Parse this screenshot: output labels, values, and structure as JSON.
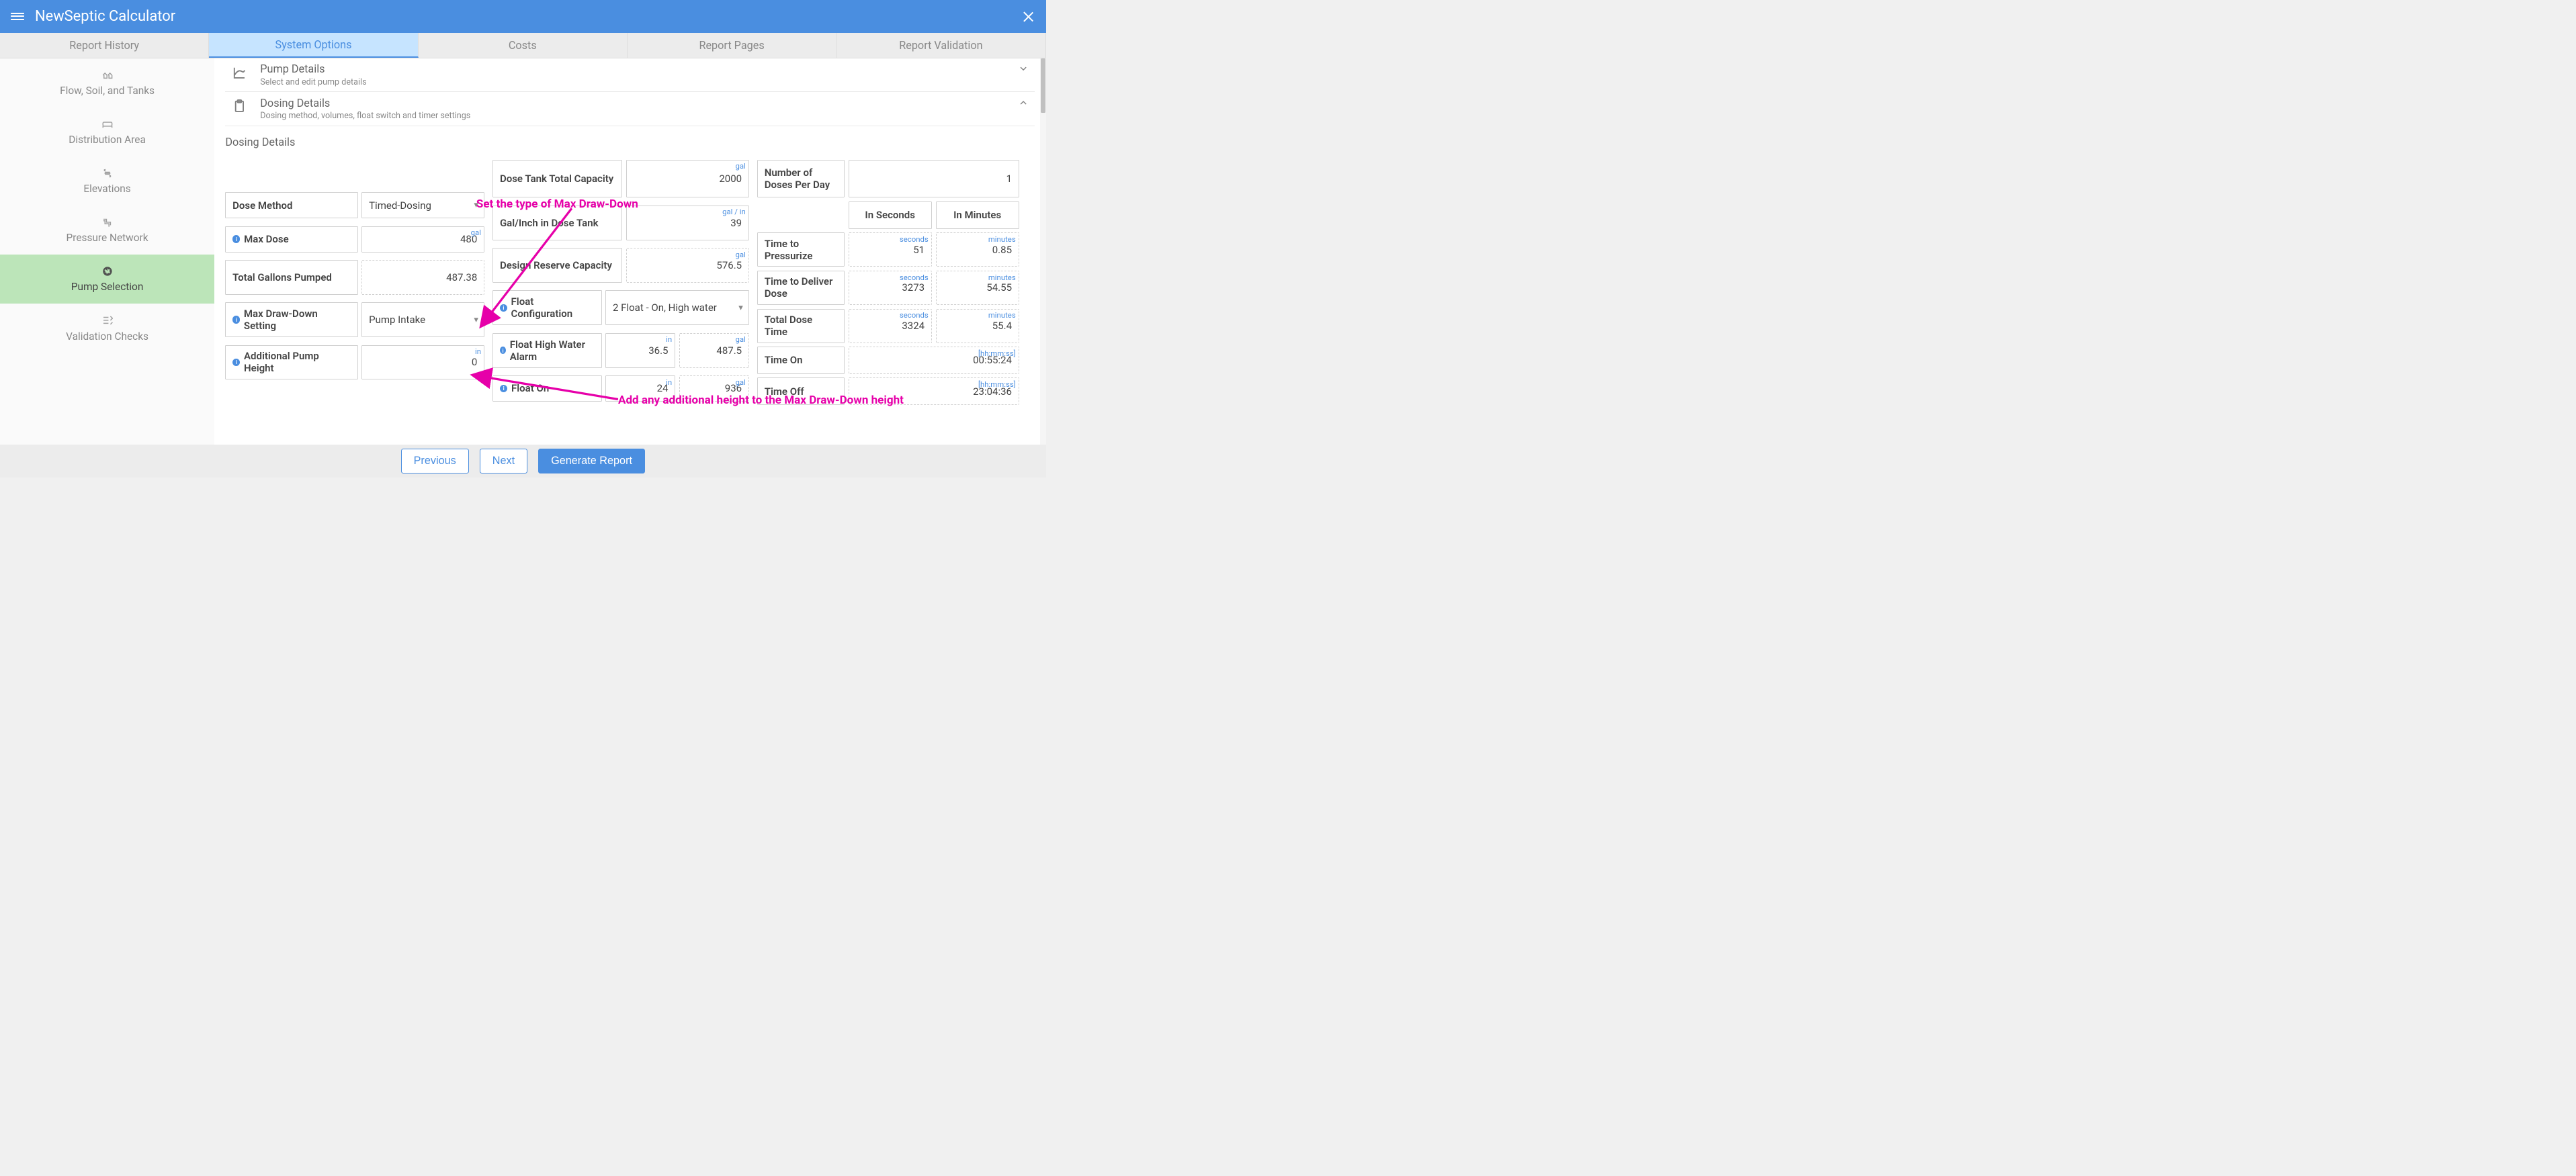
{
  "header": {
    "title": "NewSeptic Calculator"
  },
  "tabs": [
    {
      "label": "Report History"
    },
    {
      "label": "System Options"
    },
    {
      "label": "Costs"
    },
    {
      "label": "Report Pages"
    },
    {
      "label": "Report Validation"
    }
  ],
  "sidebar": [
    {
      "label": "Flow, Soil, and Tanks"
    },
    {
      "label": "Distribution Area"
    },
    {
      "label": "Elevations"
    },
    {
      "label": "Pressure Network"
    },
    {
      "label": "Pump Selection"
    },
    {
      "label": "Validation Checks"
    }
  ],
  "panels": {
    "pump": {
      "title": "Pump Details",
      "subtitle": "Select and edit pump details"
    },
    "dosing": {
      "title": "Dosing Details",
      "subtitle": "Dosing method, volumes, float switch and timer settings",
      "section_label": "Dosing Details"
    }
  },
  "col1": {
    "dose_method_label": "Dose Method",
    "dose_method_value": "Timed-Dosing",
    "max_dose_label": "Max Dose",
    "max_dose_value": "480",
    "max_dose_unit": "gal",
    "total_gallons_label": "Total Gallons Pumped",
    "total_gallons_value": "487.38",
    "max_drawdown_label": "Max Draw-Down Setting",
    "max_drawdown_value": "Pump Intake",
    "addl_pump_height_label": "Additional Pump Height",
    "addl_pump_height_value": "0",
    "addl_pump_height_unit": "in"
  },
  "col2": {
    "dose_tank_label": "Dose Tank Total Capacity",
    "dose_tank_value": "2000",
    "dose_tank_unit": "gal",
    "gal_inch_label": "Gal/Inch in Dose Tank",
    "gal_inch_value": "39",
    "gal_inch_unit": "gal / in",
    "design_reserve_label": "Design Reserve Capacity",
    "design_reserve_value": "576.5",
    "design_reserve_unit": "gal",
    "float_config_label": "Float Configuration",
    "float_config_value": "2 Float - On, High water",
    "float_high_label": "Float High Water Alarm",
    "float_high_in": "36.5",
    "float_high_gal": "487.5",
    "float_on_label": "Float On",
    "float_on_in": "24",
    "float_on_gal": "936",
    "unit_in": "in",
    "unit_gal": "gal"
  },
  "col3": {
    "num_doses_label": "Number of Doses Per Day",
    "num_doses_value": "1",
    "header_seconds": "In Seconds",
    "header_minutes": "In Minutes",
    "time_pressurize_label": "Time to Pressurize",
    "time_pressurize_sec": "51",
    "time_pressurize_min": "0.85",
    "time_deliver_label": "Time to Deliver Dose",
    "time_deliver_sec": "3273",
    "time_deliver_min": "54.55",
    "total_dose_label": "Total Dose Time",
    "total_dose_sec": "3324",
    "total_dose_min": "55.4",
    "time_on_label": "Time On",
    "time_on_value": "00:55:24",
    "time_off_label": "Time Off",
    "time_off_value": "23:04:36",
    "unit_seconds": "seconds",
    "unit_minutes": "minutes",
    "unit_hms": "[hh:mm:ss]"
  },
  "annotations": {
    "ann1": "Set the type of Max Draw-Down",
    "ann2": "Add any additional height to the Max Draw-Down height"
  },
  "footer": {
    "previous": "Previous",
    "next": "Next",
    "generate": "Generate Report"
  }
}
